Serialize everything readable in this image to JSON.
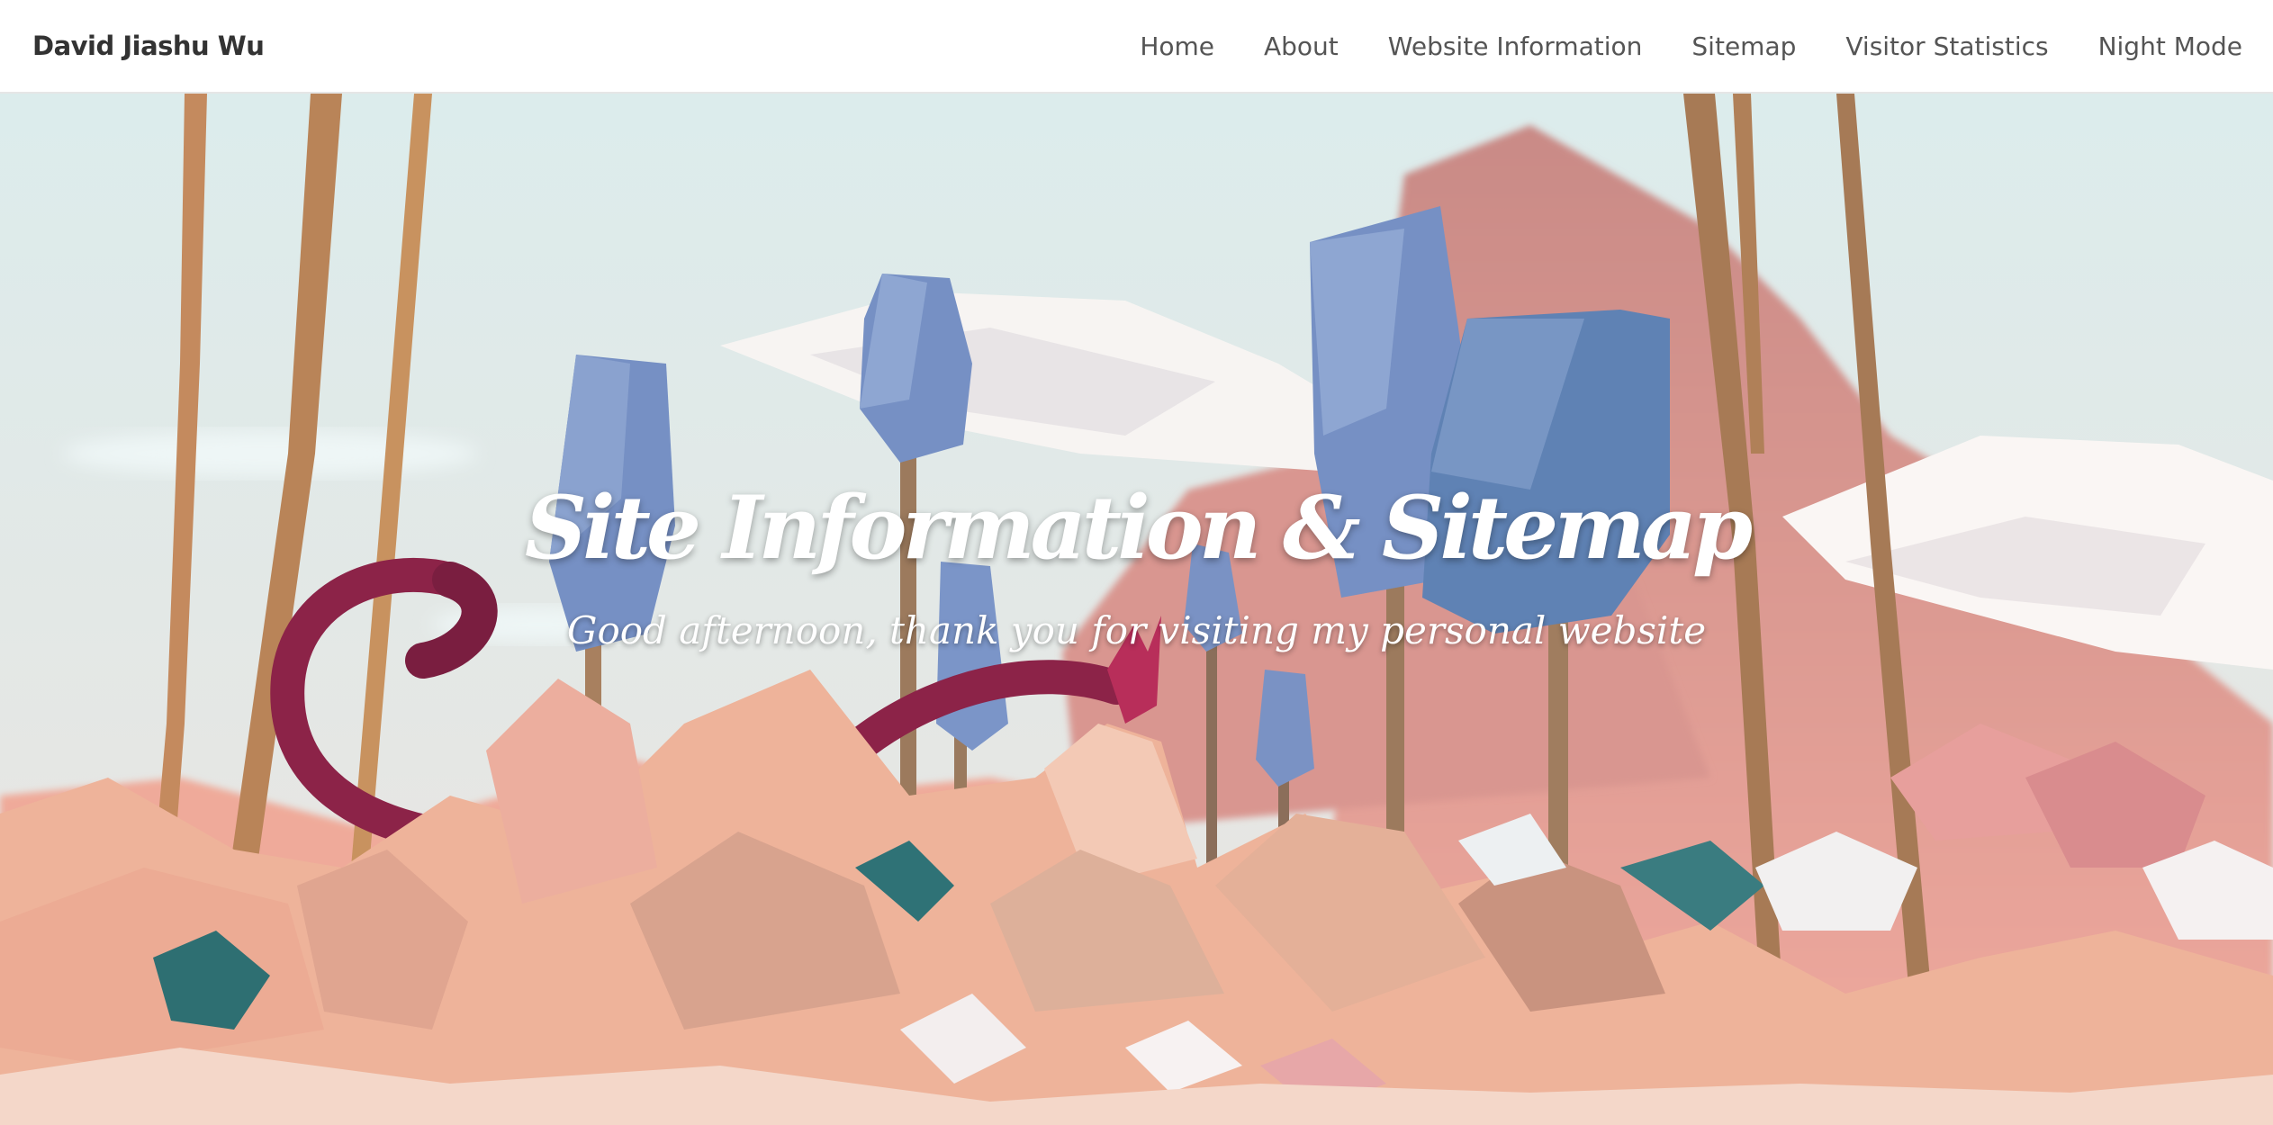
{
  "navbar": {
    "brand": "David Jiashu Wu",
    "links": [
      {
        "label": "Home"
      },
      {
        "label": "About"
      },
      {
        "label": "Website Information"
      },
      {
        "label": "Sitemap"
      },
      {
        "label": "Visitor Statistics"
      },
      {
        "label": "Night Mode"
      }
    ]
  },
  "hero": {
    "title": "Site Information & Sitemap",
    "subtitle": "Good afternoon, thank you for visiting my personal website"
  },
  "colors": {
    "navbar_bg": "#ffffff",
    "brand_text": "#333333",
    "nav_text": "#555555",
    "sky": "#d9ecec",
    "mountain_pink": "#e8a39b",
    "tree_blue": "#6f8fc0",
    "rock_peach": "#f0b59a",
    "dragon_red": "#a02650"
  }
}
